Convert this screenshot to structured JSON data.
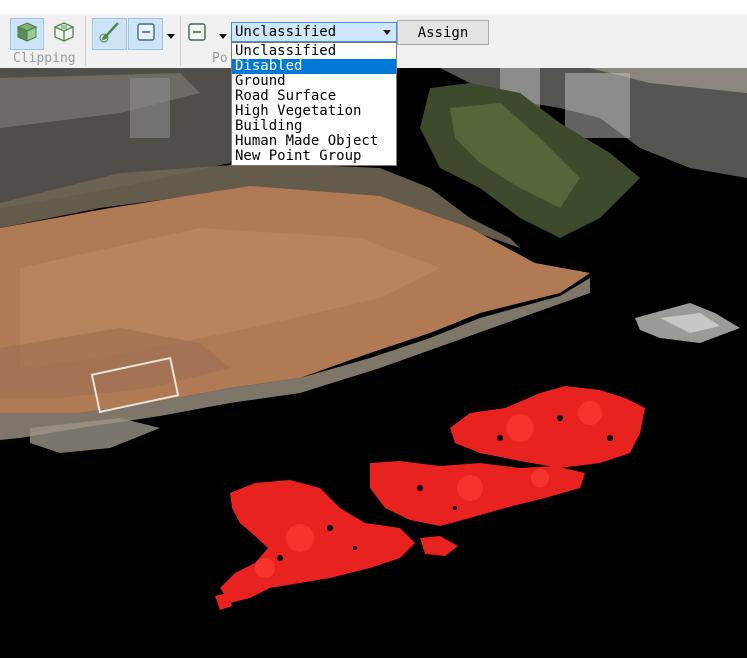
{
  "toolbar": {
    "clipping_label": "Clipping",
    "points_label_partial": "Po",
    "class_combo_value": "Unclassified",
    "assign_label": "Assign"
  },
  "dropdown": {
    "items": [
      {
        "label": "Unclassified"
      },
      {
        "label": "Disabled"
      },
      {
        "label": "Ground"
      },
      {
        "label": "Road Surface"
      },
      {
        "label": "High Vegetation"
      },
      {
        "label": "Building"
      },
      {
        "label": "Human Made Object"
      },
      {
        "label": "New Point Group"
      }
    ],
    "highlighted_index": 1
  },
  "icons": [
    "clip-box-icon",
    "clip-box-outline-icon",
    "brush-select-icon",
    "minus-select-icon",
    "dropdown-arrow-icon",
    "minus-select-icon"
  ],
  "colors": {
    "selection_highlight": "#0078d7",
    "active_button": "#cde3f6",
    "selected_points": "#e8231f",
    "ground": "#b07a55"
  }
}
